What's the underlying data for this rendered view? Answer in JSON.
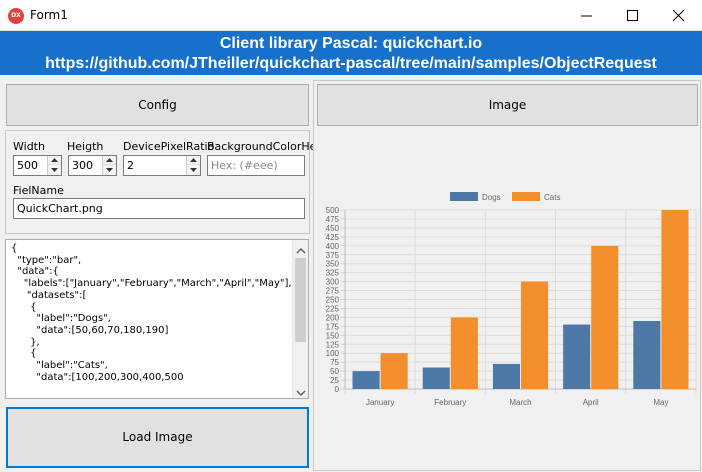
{
  "window": {
    "title": "Form1"
  },
  "header": {
    "line1": "Client library Pascal: quickchart.io",
    "line2": "https://github.com/JTheiller/quickchart-pascal/tree/main/samples/ObjectRequest"
  },
  "buttons": {
    "config": "Config",
    "image": "Image",
    "load": "Load Image"
  },
  "fields": {
    "width_label": "Width",
    "width_value": "500",
    "height_label": "Heigth",
    "height_value": "300",
    "dpr_label": "DevicePixelRatio",
    "dpr_value": "2",
    "bg_label": "BackgroundColorHex",
    "bg_placeholder": "Hex: (#eee)",
    "filename_label": "FielName",
    "filename_value": "QuickChart.png"
  },
  "memo": {
    "text": "{\n  \"type\":\"bar\",\n  \"data\":{\n    \"labels\":[\"January\",\"February\",\"March\",\"April\",\"May\"],\n     \"datasets\":[\n      {\n        \"label\":\"Dogs\",\n        \"data\":[50,60,70,180,190]\n      },\n      {\n        \"label\":\"Cats\",\n        \"data\":[100,200,300,400,500"
  },
  "chart_data": {
    "type": "bar",
    "categories": [
      "January",
      "February",
      "March",
      "April",
      "May"
    ],
    "series": [
      {
        "name": "Dogs",
        "values": [
          50,
          60,
          70,
          180,
          190
        ],
        "color": "#4e79a7"
      },
      {
        "name": "Cats",
        "values": [
          100,
          200,
          300,
          400,
          500
        ],
        "color": "#f28e2b"
      }
    ],
    "ylim": [
      0,
      500
    ],
    "yticks": [
      "0",
      "25",
      "50",
      "75",
      "100",
      "125",
      "150",
      "175",
      "200",
      "225",
      "250",
      "275",
      "300",
      "325",
      "350",
      "375",
      "400",
      "425",
      "450",
      "475",
      "500"
    ],
    "legend": "top",
    "grid": true
  }
}
